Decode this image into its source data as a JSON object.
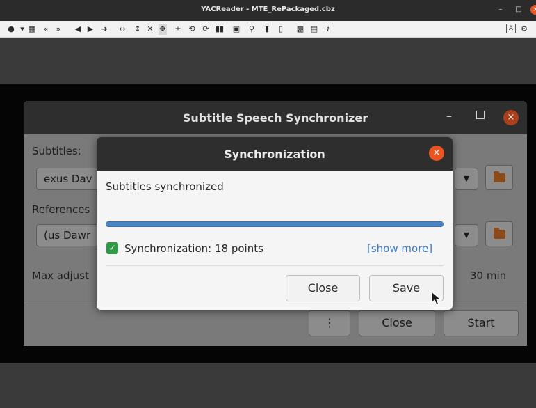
{
  "window": {
    "title": "YACReader - MTE_RePackaged.cbz",
    "minimize": "–",
    "maximize": "□",
    "close": "×"
  },
  "toolbar": {
    "left_icons": [
      "comment-icon",
      "grid-icon",
      "rewind-icon",
      "fast-forward-icon",
      "prev-icon",
      "next-icon",
      "forward-arrow-icon",
      "fit-width-icon",
      "fit-height-icon",
      "no-fit-icon",
      "fit-page-icon",
      "zoom-icon",
      "rotate-left-icon",
      "rotate-right-icon",
      "double-page-icon",
      "manga-icon",
      "magnifier-icon",
      "bookmark-icon",
      "show-bookmarks-icon",
      "goto-page-icon",
      "translator-icon",
      "info-icon"
    ],
    "right_icons": [
      "fullscreen-icon",
      "settings-icon"
    ]
  },
  "main_window": {
    "title": "Subtitle Speech Synchronizer",
    "subtitles_label": "Subtitles:",
    "subtitles_value": "exus Dav",
    "references_label": "References",
    "references_value": "(us Dawr",
    "max_adjust_label": "Max adjust",
    "max_adjust_value": "30 min",
    "more_button": "⋮",
    "close_button": "Close",
    "start_button": "Start",
    "dropdown_glyph": "▼"
  },
  "sync_dialog": {
    "title": "Synchronization",
    "message": "Subtitles synchronized",
    "progress": 1.0,
    "status": "Synchronization: 18 points",
    "show_more": "[show more]",
    "close_button": "Close",
    "save_button": "Save",
    "check_glyph": "✓",
    "close_glyph": "×"
  },
  "colors": {
    "accent_orange": "#e95420",
    "progress_blue": "#4a82c4",
    "link_blue": "#3f7cc6",
    "check_green": "#2e9a44"
  }
}
